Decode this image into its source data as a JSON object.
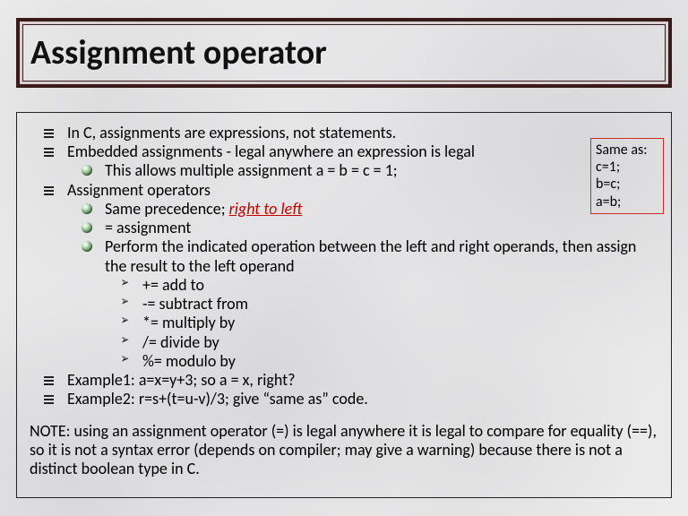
{
  "title": "Assignment operator",
  "sidebox": [
    "Same as:",
    "c=1;",
    "b=c;",
    "a=b;"
  ],
  "bullets": {
    "b1": "In C, assignments are expressions, not statements.",
    "b2": "Embedded assignments - legal anywhere an expression is legal",
    "b2a": "This allows multiple assignment a = b = c = 1;",
    "b3": "Assignment operators",
    "b3a_pre": "Same precedence; ",
    "b3a_em": "right to left",
    "b3b": "= assignment",
    "b3c": "Perform the indicated operation between the left and right operands, then assign the result to the left operand",
    "b3c1": "+= add to",
    "b3c2": "-= subtract from",
    "b3c3": "*= multiply by",
    "b3c4": "/= divide by",
    "b3c5": "%= modulo by",
    "b4": "Example1: a=x=y+3; so a = x, right?",
    "b5": "Example2: r=s+(t=u-v)/3; give “same as” code."
  },
  "note": "NOTE: using an assignment operator (=) is legal anywhere it is legal to compare for equality (==), so it is not a syntax error (depends on compiler; may give a warning) because there is not a distinct boolean type in C."
}
